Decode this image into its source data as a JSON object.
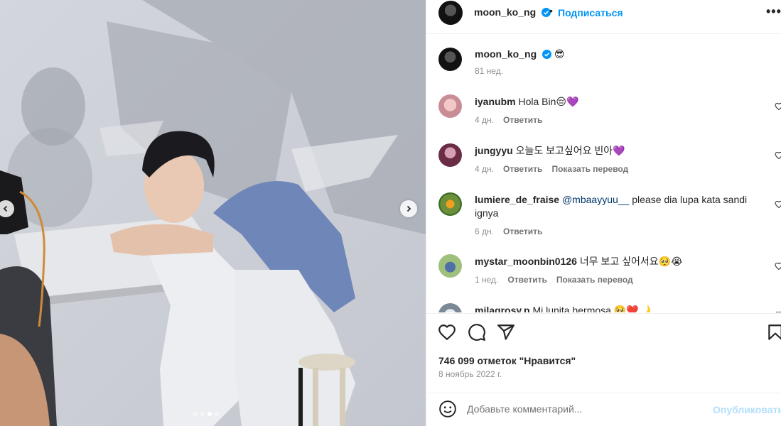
{
  "post_author": {
    "username": "moon_ko_ng",
    "follow_label": "Подписаться",
    "separator": "•",
    "more_label": "•••",
    "caption_emoji": "😎",
    "caption_age": "81 нед."
  },
  "comments": [
    {
      "user": "iyanubm",
      "text": "Hola Bin😔💜",
      "age": "4 дн.",
      "reply": "Ответить",
      "translate": ""
    },
    {
      "user": "jungyyu",
      "text": "오늘도 보고싶어요 빈아💜",
      "age": "4 дн.",
      "reply": "Ответить",
      "translate": "Показать перевод"
    },
    {
      "user": "lumiere_de_fraise",
      "mention": "@mbaayyuu__",
      "text": " please dia lupa kata sandi ignya",
      "age": "6 дн.",
      "reply": "Ответить",
      "translate": ""
    },
    {
      "user": "mystar_moonbin0126",
      "text": "너무 보고 싶어서요🥺😭",
      "age": "1 нед.",
      "reply": "Ответить",
      "translate": "Показать перевод"
    },
    {
      "user": "milagrosy.p",
      "text": "Mi lunita hermosa 🥺❤️🌙",
      "age": "",
      "reply": "",
      "translate": ""
    }
  ],
  "engagement": {
    "likes": "746 099 отметок \"Нравится\"",
    "date": "8 ноябрь 2022 г."
  },
  "composer": {
    "placeholder": "Добавьте комментарий...",
    "publish_label": "Опубликовать"
  },
  "carousel": {
    "total": 4,
    "active": 3
  },
  "icons": [
    "verified-badge-icon",
    "more-icon",
    "heart-icon",
    "comment-icon",
    "share-icon",
    "bookmark-icon",
    "emoji-icon",
    "chevron-left-icon",
    "chevron-right-icon"
  ],
  "colors": {
    "accent": "#0095f6",
    "mention": "#00376b",
    "muted": "#8e8e8e",
    "publish_disabled": "#b3dffc"
  }
}
